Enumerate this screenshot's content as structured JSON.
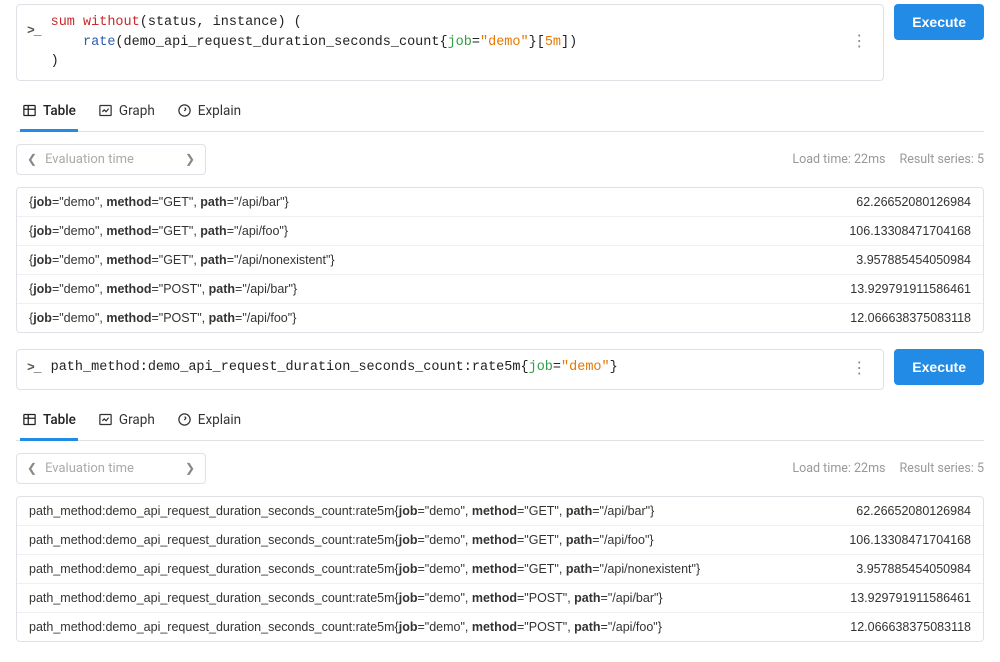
{
  "buttons": {
    "execute": "Execute"
  },
  "tabs": {
    "table": "Table",
    "graph": "Graph",
    "explain": "Explain"
  },
  "eval_time_placeholder": "Evaluation time",
  "panels": [
    {
      "query": {
        "tokens": [
          {
            "t": "sum",
            "c": "kw-red"
          },
          {
            "t": " "
          },
          {
            "t": "without",
            "c": "kw-red"
          },
          {
            "t": "(status, instance) (\n"
          },
          {
            "t": "    "
          },
          {
            "t": "rate",
            "c": "kw-blue"
          },
          {
            "t": "(demo_api_request_duration_seconds_count{"
          },
          {
            "t": "job",
            "c": "kw-green"
          },
          {
            "t": "="
          },
          {
            "t": "\"demo\"",
            "c": "kw-orange"
          },
          {
            "t": "}["
          },
          {
            "t": "5m",
            "c": "kw-orange"
          },
          {
            "t": "])\n)"
          }
        ],
        "multiline": true
      },
      "load_time": "Load time: 22ms",
      "result_series": "Result series: 5",
      "results": [
        {
          "prefix": "",
          "labels": [
            [
              "job",
              "demo"
            ],
            [
              "method",
              "GET"
            ],
            [
              "path",
              "/api/bar"
            ]
          ],
          "value": "62.26652080126984"
        },
        {
          "prefix": "",
          "labels": [
            [
              "job",
              "demo"
            ],
            [
              "method",
              "GET"
            ],
            [
              "path",
              "/api/foo"
            ]
          ],
          "value": "106.13308471704168"
        },
        {
          "prefix": "",
          "labels": [
            [
              "job",
              "demo"
            ],
            [
              "method",
              "GET"
            ],
            [
              "path",
              "/api/nonexistent"
            ]
          ],
          "value": "3.957885454050984"
        },
        {
          "prefix": "",
          "labels": [
            [
              "job",
              "demo"
            ],
            [
              "method",
              "POST"
            ],
            [
              "path",
              "/api/bar"
            ]
          ],
          "value": "13.929791911586461"
        },
        {
          "prefix": "",
          "labels": [
            [
              "job",
              "demo"
            ],
            [
              "method",
              "POST"
            ],
            [
              "path",
              "/api/foo"
            ]
          ],
          "value": "12.066638375083118"
        }
      ]
    },
    {
      "query": {
        "tokens": [
          {
            "t": "path_method:demo_api_request_duration_seconds_count:rate5m{"
          },
          {
            "t": "job",
            "c": "kw-green"
          },
          {
            "t": "="
          },
          {
            "t": "\"demo\"",
            "c": "kw-orange"
          },
          {
            "t": "}"
          }
        ],
        "multiline": false
      },
      "load_time": "Load time: 22ms",
      "result_series": "Result series: 5",
      "results": [
        {
          "prefix": "path_method:demo_api_request_duration_seconds_count:rate5m",
          "labels": [
            [
              "job",
              "demo"
            ],
            [
              "method",
              "GET"
            ],
            [
              "path",
              "/api/bar"
            ]
          ],
          "value": "62.26652080126984"
        },
        {
          "prefix": "path_method:demo_api_request_duration_seconds_count:rate5m",
          "labels": [
            [
              "job",
              "demo"
            ],
            [
              "method",
              "GET"
            ],
            [
              "path",
              "/api/foo"
            ]
          ],
          "value": "106.13308471704168"
        },
        {
          "prefix": "path_method:demo_api_request_duration_seconds_count:rate5m",
          "labels": [
            [
              "job",
              "demo"
            ],
            [
              "method",
              "GET"
            ],
            [
              "path",
              "/api/nonexistent"
            ]
          ],
          "value": "3.957885454050984"
        },
        {
          "prefix": "path_method:demo_api_request_duration_seconds_count:rate5m",
          "labels": [
            [
              "job",
              "demo"
            ],
            [
              "method",
              "POST"
            ],
            [
              "path",
              "/api/bar"
            ]
          ],
          "value": "13.929791911586461"
        },
        {
          "prefix": "path_method:demo_api_request_duration_seconds_count:rate5m",
          "labels": [
            [
              "job",
              "demo"
            ],
            [
              "method",
              "POST"
            ],
            [
              "path",
              "/api/foo"
            ]
          ],
          "value": "12.066638375083118"
        }
      ]
    }
  ]
}
